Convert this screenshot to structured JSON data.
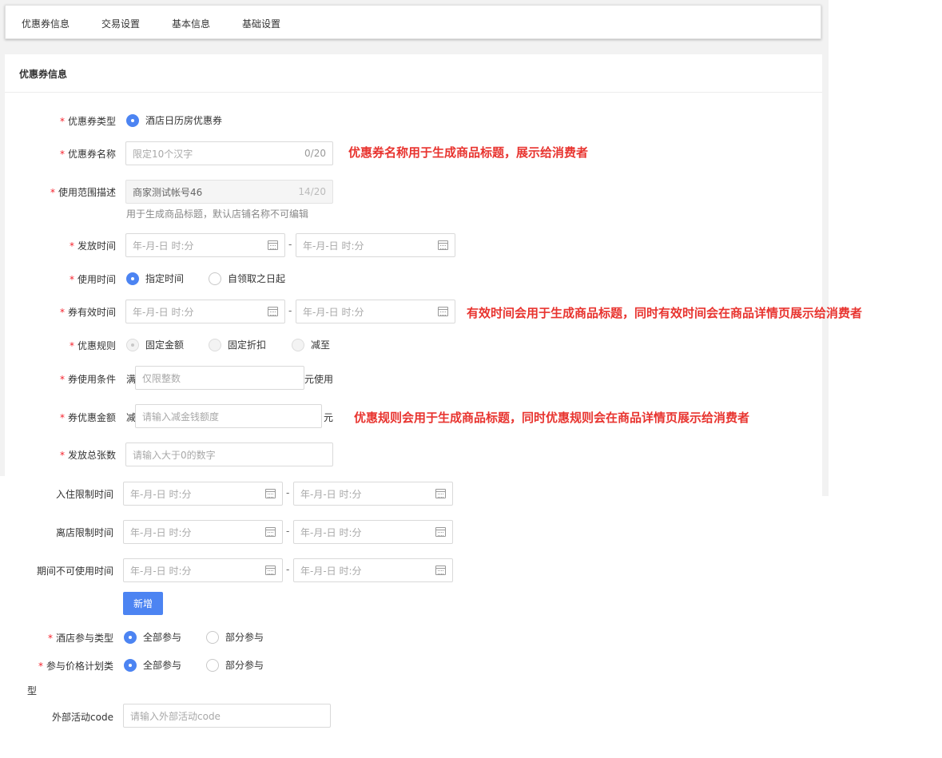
{
  "nav": {
    "tabs": [
      "优惠券信息",
      "交易设置",
      "基本信息",
      "基础设置"
    ]
  },
  "panel": {
    "title": "优惠券信息"
  },
  "form": {
    "coupon_type": {
      "label": "优惠券类型",
      "option": "酒店日历房优惠券"
    },
    "coupon_name": {
      "label": "优惠券名称",
      "placeholder": "限定10个汉字",
      "count": "0/20"
    },
    "scope_desc": {
      "label": "使用范围描述",
      "value": "商家测试帐号46",
      "count": "14/20",
      "hint": "用于生成商品标题，默认店铺名称不可编辑"
    },
    "issue_time": {
      "label": "发放时间",
      "start_placeholder": "年-月-日 时:分",
      "end_placeholder": "年-月-日 时:分",
      "separator": "-"
    },
    "use_time": {
      "label": "使用时间",
      "options": [
        "指定时间",
        "自领取之日起"
      ]
    },
    "valid_time": {
      "label": "券有效时间",
      "start_placeholder": "年-月-日 时:分",
      "end_placeholder": "年-月-日 时:分",
      "separator": "-"
    },
    "discount_rule": {
      "label": "优惠规则",
      "options": [
        "固定金额",
        "固定折扣",
        "减至"
      ]
    },
    "use_condition": {
      "label": "券使用条件",
      "prefix": "满",
      "placeholder": "仅限整数",
      "suffix": "元使用"
    },
    "discount_amount": {
      "label": "券优惠金额",
      "prefix": "减",
      "placeholder": "请输入减金钱额度",
      "suffix": "元"
    },
    "total_count": {
      "label": "发放总张数",
      "placeholder": "请输入大于0的数字"
    },
    "checkin_limit": {
      "label": "入住限制时间",
      "start_placeholder": "年-月-日 时:分",
      "end_placeholder": "年-月-日 时:分",
      "separator": "-"
    },
    "checkout_limit": {
      "label": "离店限制时间",
      "start_placeholder": "年-月-日 时:分",
      "end_placeholder": "年-月-日 时:分",
      "separator": "-"
    },
    "blackout_time": {
      "label": "期间不可使用时间",
      "start_placeholder": "年-月-日 时:分",
      "end_placeholder": "年-月-日 时:分",
      "separator": "-"
    },
    "add_button": "新增",
    "hotel_participation": {
      "label": "酒店参与类型",
      "options": [
        "全部参与",
        "部分参与"
      ]
    },
    "rate_plan_participation": {
      "label_line1": "参与价格计划类",
      "label_line2": "型",
      "options": [
        "全部参与",
        "部分参与"
      ]
    },
    "external_code": {
      "label": "外部活动code",
      "placeholder": "请输入外部活动code"
    },
    "required_mark": "*"
  },
  "annotations": {
    "name": "优惠券名称用于生成商品标题，展示给消费者",
    "valid_time": "有效时间会用于生成商品标题，同时有效时间会在商品详情页展示给消费者",
    "rule": "优惠规则会用于生成商品标题，同时优惠规则会在商品详情页展示给消费者"
  },
  "colors": {
    "accent": "#4c84f2",
    "required": "#f5222d",
    "annotation": "#e8342f"
  }
}
